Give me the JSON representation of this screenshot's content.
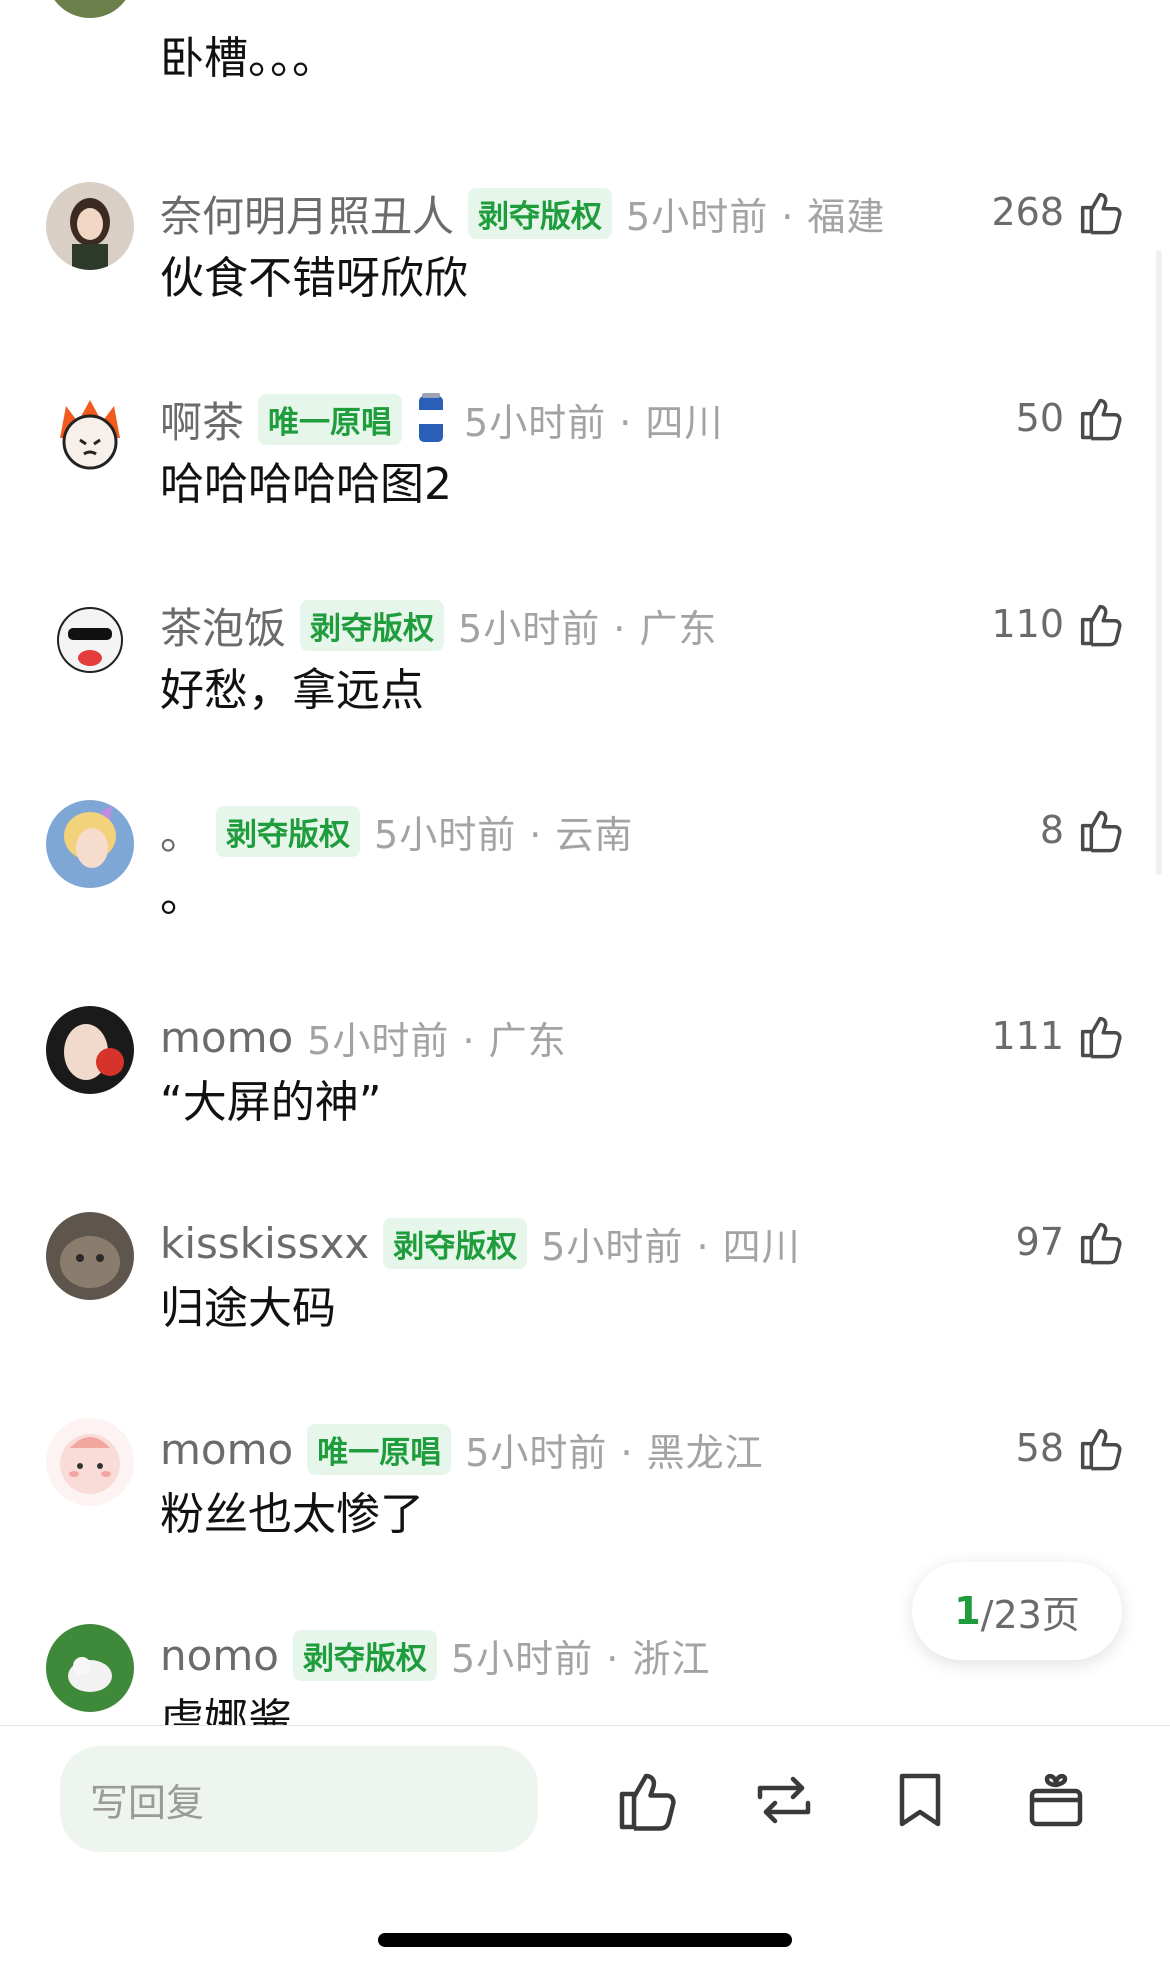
{
  "comments": [
    {
      "user": "",
      "badge": "",
      "time": "",
      "text": "卧槽。。。",
      "likes": ""
    },
    {
      "user": "奈何明月照丑人",
      "badge": "剥夺版权",
      "time": "5小时前 · 福建",
      "text": "伙食不错呀欣欣",
      "likes": "268"
    },
    {
      "user": "啊茶",
      "badge": "唯一原唱",
      "time": "5小时前 · 四川",
      "text": "哈哈哈哈哈图2",
      "likes": "50"
    },
    {
      "user": "茶泡饭",
      "badge": "剥夺版权",
      "time": "5小时前 · 广东",
      "text": "好愁，拿远点",
      "likes": "110"
    },
    {
      "user": "。",
      "badge": "剥夺版权",
      "time": "5小时前 · 云南",
      "text": "。",
      "likes": "8"
    },
    {
      "user": "momo",
      "badge": "",
      "time": "5小时前 · 广东",
      "text": "“大屏的神”",
      "likes": "111"
    },
    {
      "user": "kisskissxx",
      "badge": "剥夺版权",
      "time": "5小时前 · 四川",
      "text": "归途大码",
      "likes": "97"
    },
    {
      "user": "momo",
      "badge": "唯一原唱",
      "time": "5小时前 · 黑龙江",
      "text": "粉丝也太惨了",
      "likes": "58"
    },
    {
      "user": "nomo",
      "badge": "剥夺版权",
      "time": "5小时前 · 浙江",
      "text": "虐娜酱",
      "likes": ""
    }
  ],
  "pager": {
    "current": "1",
    "total": "/23页"
  },
  "reply_box": {
    "placeholder": "写回复"
  },
  "icons": {
    "like": "thumbs-up-icon",
    "repost": "repost-icon",
    "bookmark": "bookmark-icon",
    "gift": "gift-icon",
    "drink": "drink-can-icon"
  },
  "colors": {
    "badge_text": "#1f9d3c",
    "badge_bg": "#e6f6ea",
    "muted": "#a3a3a3"
  }
}
